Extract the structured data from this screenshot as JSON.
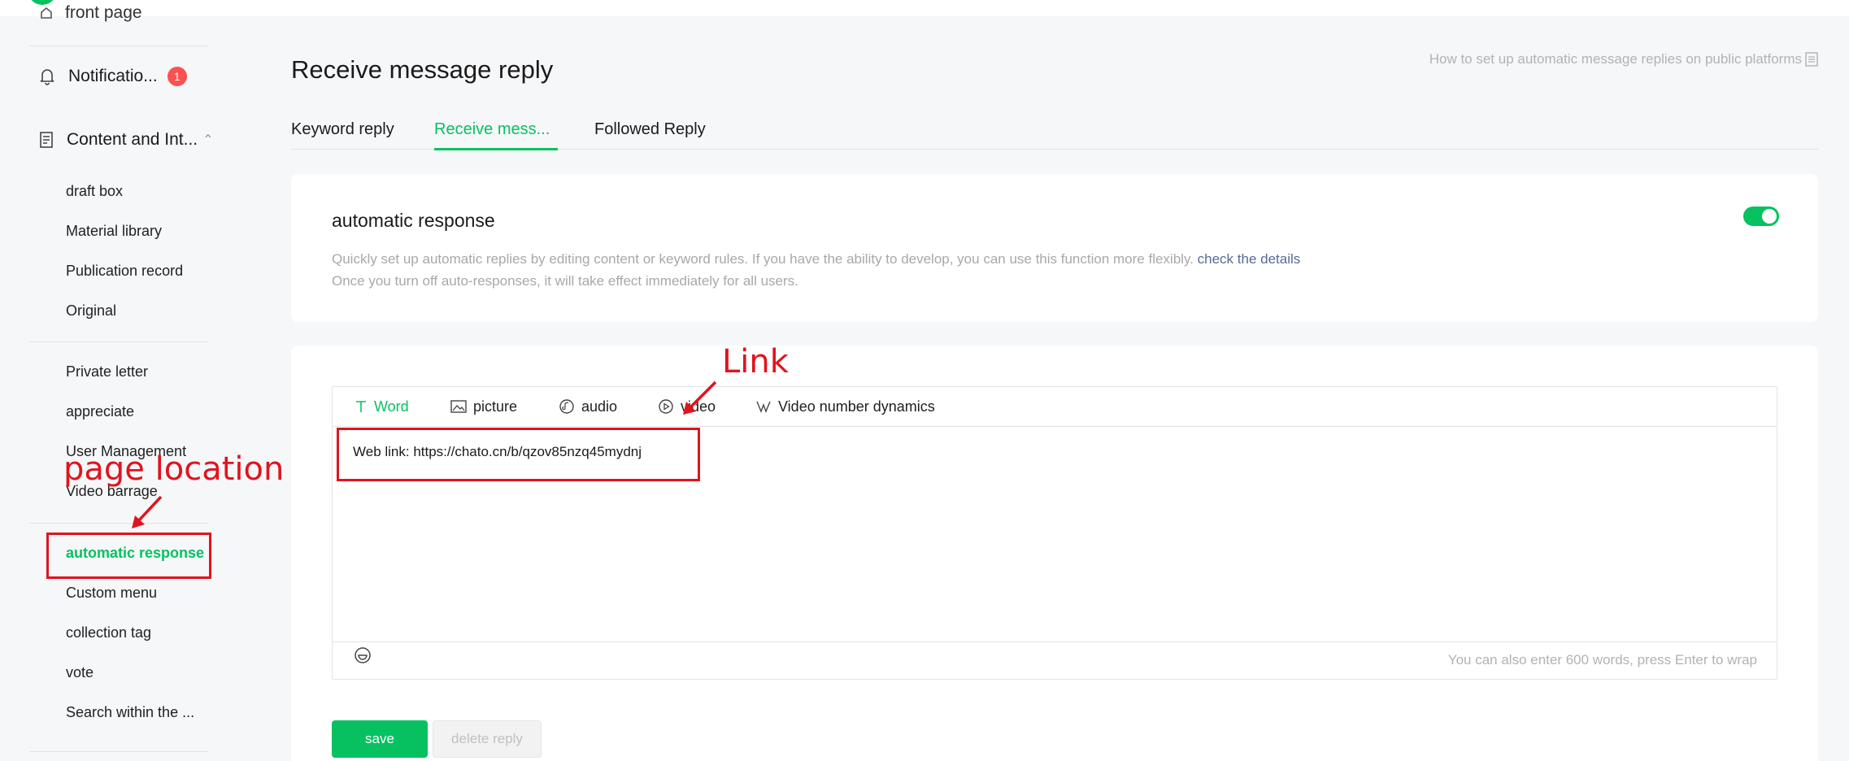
{
  "sidebar": {
    "top_item": "front page",
    "sections": [
      {
        "label": "Notificatio...",
        "badge": "1"
      },
      {
        "label": "Content and Int..."
      }
    ],
    "items": [
      "draft box",
      "Material library",
      "Publication record",
      "Original",
      "Private letter",
      "appreciate",
      "User Management",
      "Video barrage",
      "automatic response",
      "Custom menu",
      "collection tag",
      "vote",
      "Search within the ..."
    ]
  },
  "main": {
    "title": "Receive message reply",
    "help_link": "How to set up automatic message replies on public platforms",
    "tabs": [
      "Keyword reply",
      "Receive mess...",
      "Followed Reply"
    ],
    "active_tab": 1,
    "card": {
      "title": "automatic response",
      "desc_line1": "Quickly set up automatic replies by editing content or keyword rules. If you have the ability to develop, you can use this function more flexibly.",
      "details_link": "check the details",
      "desc_line2": "Once you turn off auto-responses, it will take effect immediately for all users.",
      "toggle_on": true
    },
    "editor": {
      "tabs": [
        "Word",
        "picture",
        "audio",
        "video",
        "Video number dynamics"
      ],
      "content": "Web link: https://chato.cn/b/qzov85nzq45mydnj",
      "counter": "You can also enter  600  words, press Enter to wrap"
    },
    "buttons": {
      "save": "save",
      "delete": "delete reply"
    }
  },
  "annotations": {
    "link_label": "Link",
    "page_location_label": "page location"
  },
  "colors": {
    "accent": "#07c160",
    "annotation": "#e0141e",
    "badge": "#fa5151",
    "link": "#576b95"
  }
}
